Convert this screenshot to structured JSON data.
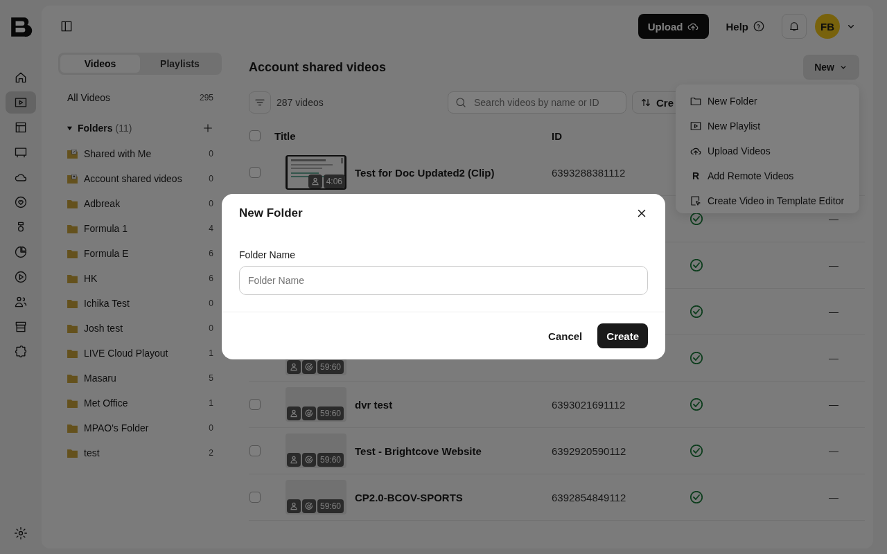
{
  "rail": {
    "items": [
      {
        "kind": "home",
        "selected": false
      },
      {
        "kind": "video",
        "selected": true
      },
      {
        "kind": "layout",
        "selected": false
      },
      {
        "kind": "screen",
        "selected": false
      },
      {
        "kind": "cloud",
        "selected": false
      },
      {
        "kind": "heart",
        "selected": false
      },
      {
        "kind": "figure",
        "selected": false
      },
      {
        "kind": "pie",
        "selected": false
      },
      {
        "kind": "play",
        "selected": false
      },
      {
        "kind": "users",
        "selected": false
      },
      {
        "kind": "store",
        "selected": false
      },
      {
        "kind": "puzzle",
        "selected": false
      }
    ]
  },
  "topbar": {
    "upload_button": "Upload",
    "help_link": "Help",
    "avatar": "FB"
  },
  "sidebar": {
    "tabs": [
      {
        "label": "Videos",
        "selected": true
      },
      {
        "label": "Playlists",
        "selected": false
      }
    ],
    "all_videos": {
      "label": "All Videos",
      "count": "295"
    },
    "folders": {
      "label": "Folders",
      "count": "(11)",
      "expanded": true,
      "items": [
        {
          "kind": "shared",
          "name": "Shared with Me",
          "count": "0"
        },
        {
          "kind": "account",
          "name": "Account shared videos",
          "count": "0"
        },
        {
          "kind": "folder",
          "name": "Adbreak",
          "count": "0"
        },
        {
          "kind": "folder",
          "name": "Formula 1",
          "count": "4"
        },
        {
          "kind": "folder",
          "name": "Formula E",
          "count": "6"
        },
        {
          "kind": "folder",
          "name": "HK",
          "count": "6"
        },
        {
          "kind": "folder",
          "name": "Ichika Test",
          "count": "0"
        },
        {
          "kind": "folder",
          "name": "Josh test",
          "count": "0"
        },
        {
          "kind": "folder",
          "name": "LIVE Cloud Playout",
          "count": "1"
        },
        {
          "kind": "folder",
          "name": "Masaru",
          "count": "5"
        },
        {
          "kind": "folder",
          "name": "Met Office",
          "count": "1"
        },
        {
          "kind": "folder",
          "name": "MPAO's Folder",
          "count": "0"
        },
        {
          "kind": "folder",
          "name": "test",
          "count": "2"
        }
      ]
    }
  },
  "main": {
    "title": "Account shared videos",
    "new_button": "New",
    "video_count": "287 videos",
    "search": {
      "placeholder": "Search videos by name or ID"
    },
    "sort_button": "Cre",
    "table": {
      "select_all_checked": false,
      "columns": [
        "Title",
        "ID"
      ],
      "rows": [
        {
          "checked": false,
          "thumb": {
            "kind": "picture",
            "duration": "4:06"
          },
          "title": "Test for Doc Updated2 (Clip)",
          "id": "6393288381112"
        },
        {
          "ok": true,
          "dash": "—"
        },
        {
          "ok": true,
          "dash": "—"
        },
        {
          "ok": true,
          "dash": "—"
        },
        {
          "thumb": {
            "kind": "placeholder",
            "duration": "59:60"
          },
          "ok": true,
          "dash": "—"
        },
        {
          "checked": false,
          "thumb": {
            "kind": "placeholder",
            "duration": "59:60"
          },
          "title": "dvr test",
          "id": "6393021691112",
          "ok": true,
          "dash": "—"
        },
        {
          "checked": false,
          "thumb": {
            "kind": "placeholder",
            "duration": "59:60"
          },
          "title": "Test - Brightcove Website",
          "id": "6392920590112",
          "ok": true,
          "dash": "—"
        },
        {
          "checked": false,
          "thumb": {
            "kind": "placeholder",
            "duration": "59:60"
          },
          "title": "CP2.0-BCOV-SPORTS",
          "id": "6392854849112",
          "ok": true,
          "dash": "—"
        }
      ]
    }
  },
  "new_menu": {
    "items": [
      {
        "kind": "folder",
        "label": "New Folder"
      },
      {
        "kind": "playlist",
        "label": "New Playlist"
      },
      {
        "kind": "upload",
        "label": "Upload Videos"
      },
      {
        "kind": "remote",
        "icon_text": "R",
        "label": "Add Remote Videos"
      },
      {
        "kind": "template",
        "label": "Create Video in Template Editor"
      }
    ]
  },
  "modal": {
    "title": "New Folder",
    "field_label": "Folder Name",
    "placeholder": "Folder Name",
    "cancel_button": "Cancel",
    "create_button": "Create"
  }
}
